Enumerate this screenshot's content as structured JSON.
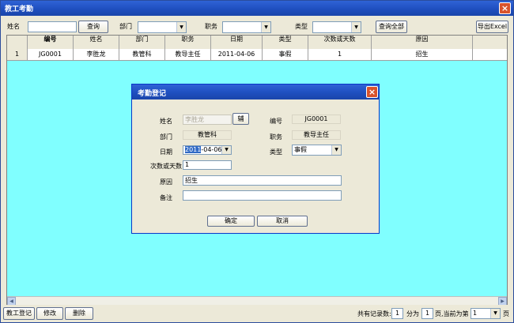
{
  "window": {
    "title": "教工考勤"
  },
  "toolbar": {
    "name_label": "姓名",
    "name_value": "",
    "query_label": "查询",
    "dept_label": "部门",
    "dept_value": "",
    "post_label": "职务",
    "post_value": "",
    "type_label": "类型",
    "type_value": "",
    "query_all_label": "查询全部",
    "export_label": "导出Excel"
  },
  "grid": {
    "columns": [
      "编号",
      "姓名",
      "部门",
      "职务",
      "日期",
      "类型",
      "次数或天数",
      "原因"
    ],
    "rows": [
      {
        "index": "1",
        "cells": [
          "JG0001",
          "李胜龙",
          "教管科",
          "教导主任",
          "2011-04-06",
          "事假",
          "1",
          "招生"
        ]
      }
    ]
  },
  "dialog": {
    "title": "考勤登记",
    "name_label": "姓名",
    "name_value": "李胜龙",
    "assist_label": "辅",
    "id_label": "编号",
    "id_value": "JG0001",
    "dept_label": "部门",
    "dept_value": "教管科",
    "post_label": "职务",
    "post_value": "教导主任",
    "date_label": "日期",
    "date_year": "2011",
    "date_rest": "-04-06",
    "type_label": "类型",
    "type_value": "事假",
    "count_label": "次数或天数",
    "count_value": "1",
    "reason_label": "原因",
    "reason_value": "招生",
    "remark_label": "备注",
    "remark_value": "",
    "ok_label": "确定",
    "cancel_label": "取消"
  },
  "status": {
    "register_label": "教工登记",
    "edit_label": "修改",
    "delete_label": "删除",
    "total_label": "共有记录数:",
    "total_value": "1",
    "divide_label": "分为",
    "pages_value": "1",
    "current_label": "页,当前为第",
    "current_value": "1",
    "page_suffix": "页"
  }
}
